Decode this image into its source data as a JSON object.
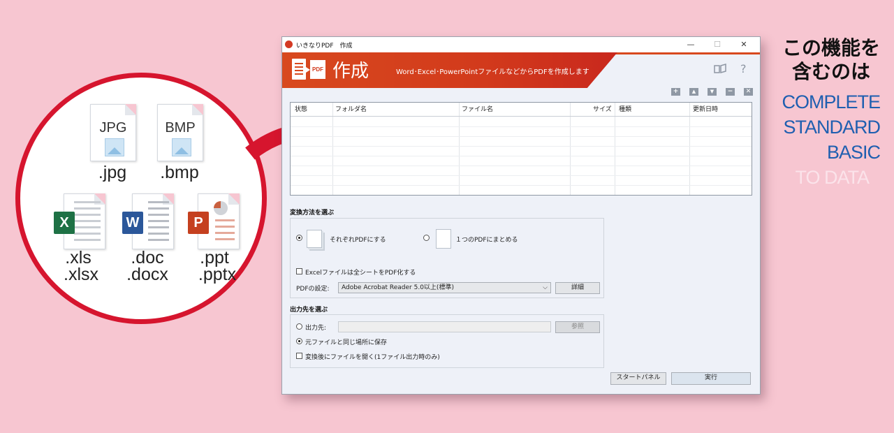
{
  "colors": {
    "background": "#f7c6d1",
    "accent_red": "#d6152e",
    "banner_orange": "#d8491e",
    "edition_blue": "#1f5fb0",
    "edition_faded": "#fbe3ea"
  },
  "promo": {
    "files": [
      {
        "icon": "jpg-file-icon",
        "type_label": "JPG",
        "ext": ".jpg"
      },
      {
        "icon": "bmp-file-icon",
        "type_label": "BMP",
        "ext": ".bmp"
      },
      {
        "icon": "excel-file-icon",
        "badge": "X",
        "ext1": ".xls",
        "ext2": ".xlsx"
      },
      {
        "icon": "word-file-icon",
        "badge": "W",
        "ext1": ".doc",
        "ext2": ".docx"
      },
      {
        "icon": "powerpoint-file-icon",
        "badge": "P",
        "ext1": ".ppt",
        "ext2": ".pptx"
      }
    ]
  },
  "window": {
    "title": "いきなりPDF　作成",
    "controls": {
      "minimize": "—",
      "maximize": "☐",
      "close": "✕"
    },
    "banner": {
      "pdf_badge": "PDF",
      "title": "作成",
      "subtitle": "Word･Excel･PowerPointファイルなどからPDFを作成します",
      "book_icon": "book-icon",
      "help_label": "?"
    },
    "toolbar": {
      "add": "+",
      "up": "▲",
      "down": "▼",
      "remove": "−",
      "clear": "✕"
    },
    "table": {
      "columns": [
        "状態",
        "フォルダ名",
        "ファイル名",
        "サイズ",
        "種類",
        "更新日時"
      ],
      "rows": []
    },
    "conversion": {
      "heading": "変換方法を選ぶ",
      "option_each": "それぞれPDFにする",
      "option_combine": "１つのPDFにまとめる",
      "selected": "each",
      "excel_all_sheets": "Excelファイルは全シートをPDF化する",
      "excel_all_sheets_checked": false,
      "pdf_setting_label": "PDFの設定:",
      "pdf_setting_value": "Adobe Acrobat Reader 5.0以上(標準)",
      "details_button": "詳細"
    },
    "output": {
      "heading": "出力先を選ぶ",
      "dest_label": "出力先:",
      "dest_value": "",
      "browse_button": "参照",
      "same_location": "元ファイルと同じ場所に保存",
      "selected": "same_location",
      "open_after": "変換後にファイルを開く(1ファイル出力時のみ)",
      "open_after_checked": false
    },
    "footer": {
      "start_panel": "スタートパネル",
      "run": "実行"
    }
  },
  "feature": {
    "heading_line1": "この機能を",
    "heading_line2": "含むのは",
    "editions": [
      {
        "name": "COMPLETE",
        "included": true
      },
      {
        "name": "STANDARD",
        "included": true
      },
      {
        "name": "BASIC",
        "included": true
      },
      {
        "name": "TO DATA",
        "included": false
      }
    ]
  }
}
